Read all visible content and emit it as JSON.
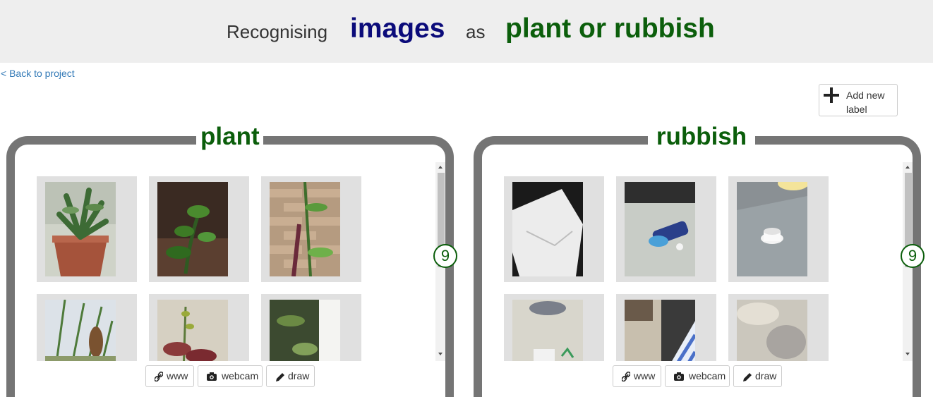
{
  "header": {
    "recognising": "Recognising",
    "images": "images",
    "as": "as",
    "labels": "plant or rubbish",
    "images_color": "#0b0b7a",
    "labels_color": "#0b5e0b"
  },
  "nav": {
    "back_link": "< Back to project"
  },
  "add_label_button": {
    "text": "Add new label"
  },
  "buckets": [
    {
      "title": "plant",
      "count": "9",
      "buttons": {
        "www": "www",
        "webcam": "webcam",
        "draw": "draw"
      },
      "images": [
        "potted plant",
        "plant leaves",
        "plant against wall",
        "plant cluster",
        "red leaf plant",
        "plant by window"
      ]
    },
    {
      "title": "rubbish",
      "count": "9",
      "buttons": {
        "www": "www",
        "webcam": "webcam",
        "draw": "draw"
      },
      "images": [
        "crumpled paper",
        "plastic bottle",
        "bottle cap",
        "cloth on floor",
        "striped bag",
        "plastic cup"
      ]
    }
  ]
}
